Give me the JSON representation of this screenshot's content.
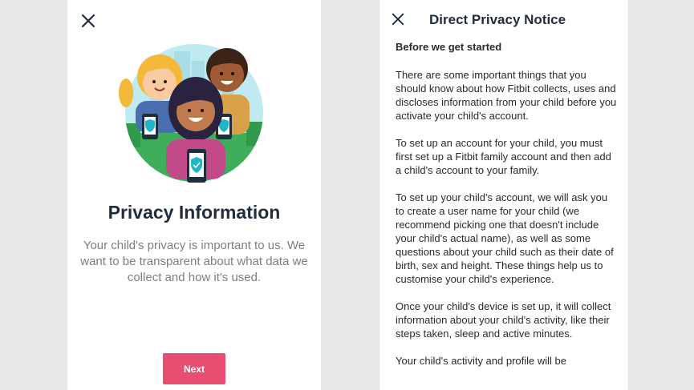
{
  "left": {
    "title": "Privacy Information",
    "description": "Your child's privacy is important to us. We want to be transparent about what data we collect and how it's used.",
    "next_label": "Next"
  },
  "right": {
    "title": "Direct Privacy Notice",
    "heading": "Before we get started",
    "paragraphs": [
      "There are some important things that you should know about how Fitbit collects, uses and discloses information from your child before you activate your child's account.",
      "To set up an account for your child, you must first set up a Fitbit family account and then add a child's account to your family.",
      "To set up your child's account, we will ask you to create a user name for your child (we recommend picking one that doesn't include your child's actual name), as well as some questions about your child such as their date of birth, sex and height. These things help us to customise your child's experience.",
      "Once your child's device is set up, it will collect information about your child's activity, like their steps taken, sleep and active minutes.",
      "Your child's activity and profile will be"
    ]
  },
  "icons": {
    "close": "close-icon",
    "shield": "shield-check-icon"
  },
  "colors": {
    "background": "#e8e8e8",
    "panel": "#ffffff",
    "title": "#1f2d3d",
    "description": "#7b7f82",
    "next_button": "#e84d72",
    "shield_accent": "#1fb6c9"
  }
}
